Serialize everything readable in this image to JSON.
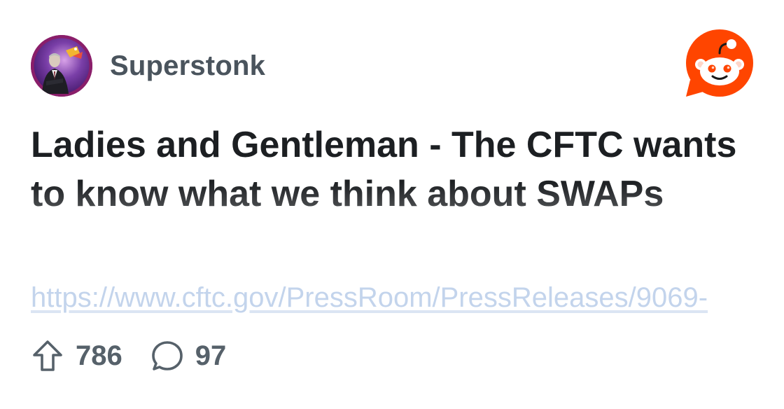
{
  "community": {
    "name": "Superstonk",
    "avatar_icon": "community-avatar"
  },
  "post": {
    "title": "Ladies and Gentleman - The CFTC wants to know what we think about SWAPs",
    "link_text": "https://www.cftc.gov/PressRoom/PressReleases/9069-"
  },
  "stats": {
    "upvotes": "786",
    "upvote_icon": "upvote-arrow-icon",
    "comments": "97",
    "comment_icon": "comment-bubble-icon"
  },
  "colors": {
    "reddit_orange": "#FF4500",
    "link": "#C3D4EC",
    "title": "#1C1F22",
    "muted": "#56616A"
  }
}
